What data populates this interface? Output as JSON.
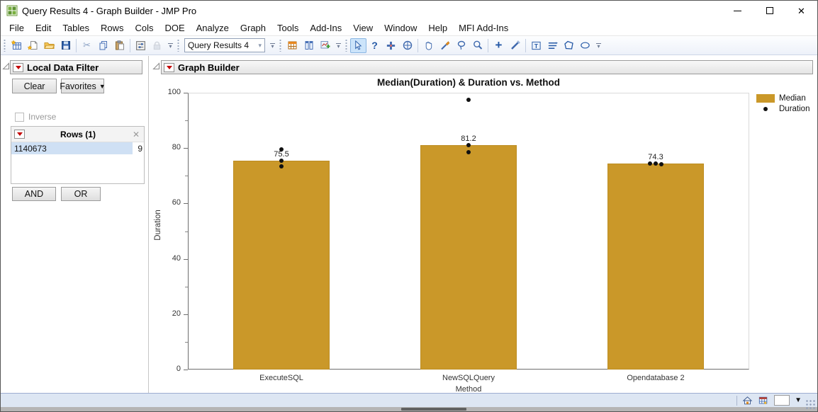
{
  "titlebar": {
    "title": "Query Results 4 - Graph Builder - JMP Pro"
  },
  "menu": {
    "items": [
      "File",
      "Edit",
      "Tables",
      "Rows",
      "Cols",
      "DOE",
      "Analyze",
      "Graph",
      "Tools",
      "Add-Ins",
      "View",
      "Window",
      "Help",
      "MFI Add-Ins"
    ]
  },
  "toolbar": {
    "window_selector": "Query Results 4"
  },
  "filter": {
    "title": "Local Data Filter",
    "clear_label": "Clear",
    "favorites_label": "Favorites",
    "inverse_label": "Inverse",
    "rows_header": "Rows (1)",
    "selected_value": "1140673",
    "selected_count": "9",
    "and_label": "AND",
    "or_label": "OR"
  },
  "graph_builder": {
    "title": "Graph Builder"
  },
  "chart_data": {
    "type": "bar",
    "title": "Median(Duration) & Duration vs. Method",
    "xlabel": "Method",
    "ylabel": "Duration",
    "ylim": [
      0,
      100
    ],
    "yticks": [
      0,
      20,
      40,
      60,
      80,
      100
    ],
    "minor_ticks": [
      10,
      30,
      50,
      70,
      90
    ],
    "grid": false,
    "legend_position": "right",
    "categories": [
      "ExecuteSQL",
      "NewSQLQuery",
      "Opendatabase 2"
    ],
    "series": [
      {
        "name": "Median",
        "type": "bar",
        "color": "#CA9829",
        "values": [
          75.5,
          81.2,
          74.3
        ],
        "labels": [
          "75.5",
          "81.2",
          "74.3"
        ]
      },
      {
        "name": "Duration",
        "type": "scatter",
        "color": "#111111",
        "points": [
          [
            79.5,
            75.5,
            73.5
          ],
          [
            97.5,
            81.2,
            78.5
          ],
          [
            74.5,
            74.3,
            74.1
          ]
        ]
      }
    ],
    "legend": [
      {
        "label": "Median",
        "marker": "swatch",
        "color": "#CA9829"
      },
      {
        "label": "Duration",
        "marker": "dot",
        "color": "#111111"
      }
    ]
  },
  "colors": {
    "bar_gold": "#CA9829",
    "selection_blue": "#cfe0f4",
    "statusbar": "#dde6f3"
  }
}
